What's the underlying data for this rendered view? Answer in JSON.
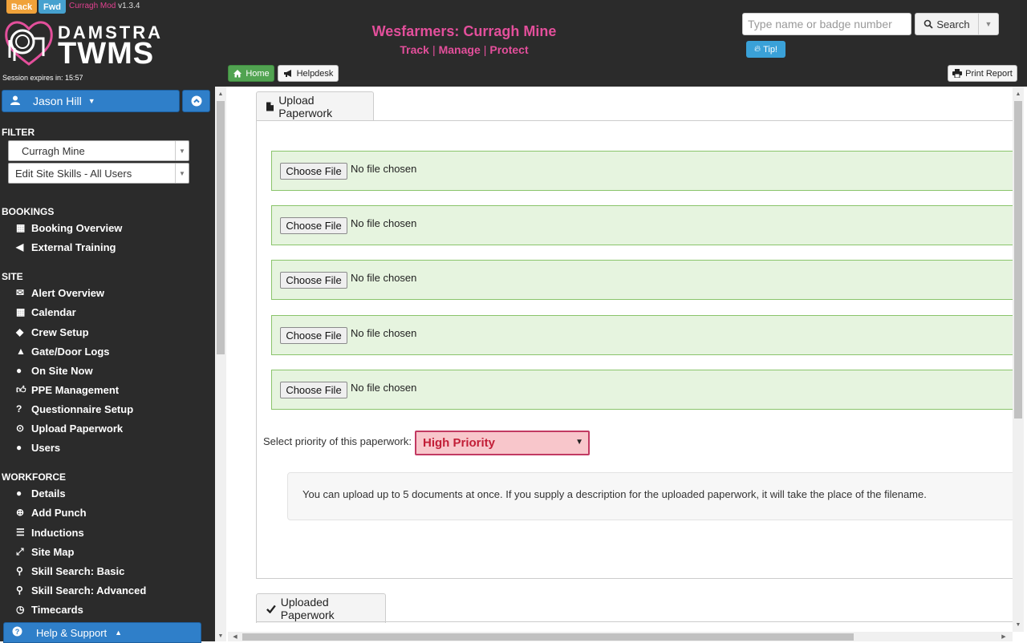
{
  "header": {
    "back_label": "Back",
    "fwd_label": "Fwd",
    "mod_name": "Curragh Mod",
    "mod_version": "v1.3.4",
    "logo_damstra": "DAMSTRA",
    "logo_twms": "TWMS",
    "session_text": "Session expires in: 15:57",
    "site_title": "Wesfarmers: Curragh Mine",
    "links": [
      "Track",
      "Manage",
      "Protect"
    ],
    "search_placeholder": "Type name or badge number",
    "search_label": "Search",
    "tip_label": "Tip!",
    "home_label": "Home",
    "helpdesk_label": "Helpdesk",
    "print_label": "Print Report"
  },
  "sidebar": {
    "user_name": "Jason Hill",
    "filter_title": "FILTER",
    "filter_site": "Curragh Mine",
    "filter_view": "Edit Site Skills - All Users",
    "sections": {
      "bookings": {
        "title": "BOOKINGS",
        "items": [
          "Booking Overview",
          "External Training"
        ]
      },
      "site": {
        "title": "SITE",
        "items": [
          "Alert Overview",
          "Calendar",
          "Crew Setup",
          "Gate/Door Logs",
          "On Site Now",
          "PPE Management",
          "Questionnaire Setup",
          "Upload Paperwork",
          "Users"
        ]
      },
      "workforce": {
        "title": "WORKFORCE",
        "items": [
          "Details",
          "Add Punch",
          "Inductions",
          "Site Map",
          "Skill Search: Basic",
          "Skill Search: Advanced",
          "Timecards"
        ]
      }
    },
    "help_label": "Help & Support"
  },
  "main": {
    "upload_tab": "Upload Paperwork",
    "file_rows": [
      {
        "button": "Choose File",
        "status": "No file chosen"
      },
      {
        "button": "Choose File",
        "status": "No file chosen"
      },
      {
        "button": "Choose File",
        "status": "No file chosen"
      },
      {
        "button": "Choose File",
        "status": "No file chosen"
      },
      {
        "button": "Choose File",
        "status": "No file chosen"
      }
    ],
    "priority_label": "Select priority of this paperwork:",
    "priority_value": "High Priority",
    "info_text": "You can upload up to 5 documents at once. If you supply a description for the uploaded paperwork, it will take the place of the filename.",
    "uploaded_tab": "Uploaded Paperwork"
  },
  "colors": {
    "accent": "#e34f9b",
    "header_bg": "#2b2b2b",
    "primary_blue": "#2f7fc9",
    "success_green": "#51a351",
    "file_row_bg": "#e6f4df",
    "priority_bg": "#f8c6cb"
  }
}
